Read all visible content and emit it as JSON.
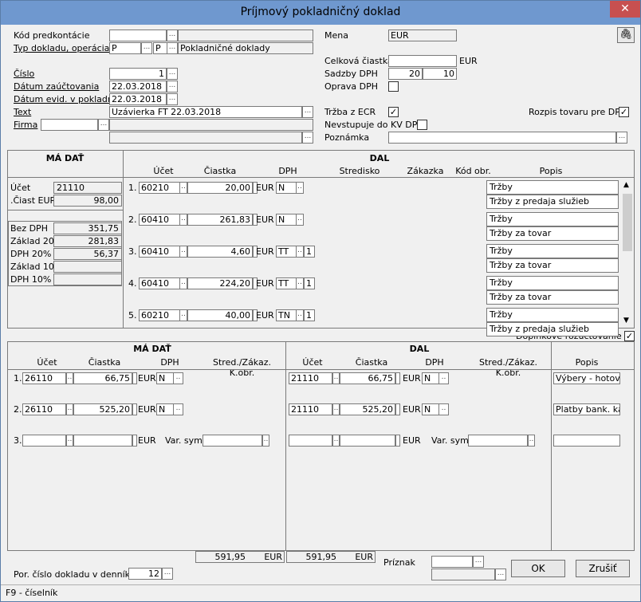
{
  "window": {
    "title": "Príjmový pokladničný doklad",
    "close": "✕"
  },
  "header": {
    "kod_label": "Kód predkontácie",
    "kod_value": "",
    "typ_label": "Typ dokladu, operácia",
    "typ_value": "P",
    "op_value": "P",
    "typ_desc": "Pokladničné doklady",
    "cislo_label": "Číslo",
    "cislo_value": "1",
    "datum_z_label": "Dátum zaúčtovania",
    "datum_z_value": "22.03.2018",
    "datum_e_label": "Dátum evid. v pokladni",
    "datum_e_value": "22.03.2018",
    "text_label": "Text",
    "text_value": "Uzávierka FT 22.03.2018",
    "firma_label": "Firma",
    "firma_value": "",
    "mena_label": "Mena",
    "mena_value": "EUR",
    "celkova_label": "Celková čiastka",
    "celkova_value": "",
    "celkova_unit": "EUR",
    "sadzby_label": "Sadzby DPH",
    "sadzba1": "20",
    "sadzba2": "10",
    "oprava_label": "Oprava DPH",
    "trzba_label": "Tržba z ECR",
    "nevstupuje_label": "Nevstupuje do KV DPH",
    "rozpis_label": "Rozpis tovaru pre DPH",
    "poznamka_label": "Poznámka",
    "poznamka_value": "",
    "attach_icon": "paperclip-icon"
  },
  "top": {
    "ma_dat_header": "MÁ DAŤ",
    "ucet_label": "Účet",
    "ucet_value": "21110",
    "ciast_label": ".Čiast EUR",
    "ciast_value": "98,00",
    "summary": [
      {
        "label": "Bez DPH",
        "value": "351,75"
      },
      {
        "label": "Základ 20%",
        "value": "281,83"
      },
      {
        "label": "DPH 20%",
        "value": "56,37"
      },
      {
        "label": "Základ 10%",
        "value": ""
      },
      {
        "label": "DPH 10%",
        "value": ""
      }
    ],
    "dal_header": "DAL",
    "cols": {
      "ucet": "Účet",
      "ciastka": "Čiastka",
      "dph": "DPH",
      "stredisko": "Stredisko",
      "zakazka": "Zákazka",
      "kod": "Kód obr.",
      "popis": "Popis"
    },
    "rows": [
      {
        "n": "1.",
        "ucet": "60210",
        "ciastka": "20,00",
        "cur": "EUR",
        "dph": "N",
        "extra": "",
        "popis1": "Tržby",
        "popis2": "Tržby z predaja služieb"
      },
      {
        "n": "2.",
        "ucet": "60410",
        "ciastka": "261,83",
        "cur": "EUR",
        "dph": "N",
        "extra": "",
        "popis1": "Tržby",
        "popis2": "Tržby za tovar"
      },
      {
        "n": "3.",
        "ucet": "60410",
        "ciastka": "4,60",
        "cur": "EUR",
        "dph": "TT",
        "extra": "1",
        "popis1": "Tržby",
        "popis2": "Tržby za tovar"
      },
      {
        "n": "4.",
        "ucet": "60410",
        "ciastka": "224,20",
        "cur": "EUR",
        "dph": "TT",
        "extra": "1",
        "popis1": "Tržby",
        "popis2": "Tržby za tovar"
      },
      {
        "n": "5.",
        "ucet": "60210",
        "ciastka": "40,00",
        "cur": "EUR",
        "dph": "TN",
        "extra": "1",
        "popis1": "Tržby",
        "popis2": "Tržby z predaja služieb"
      }
    ],
    "doplnkove_label": "Doplnkové rozúčtovanie"
  },
  "bottom": {
    "ma_dat_header": "MÁ DAŤ",
    "dal_header": "DAL",
    "cols": {
      "ucet": "Účet",
      "ciastka": "Čiastka",
      "dph": "DPH",
      "stred": "Stred./Zákaz. K.obr.",
      "popis": "Popis"
    },
    "rows": [
      {
        "n": "1.",
        "md_ucet": "26110",
        "md_ciastka": "66,75",
        "cur": "EUR",
        "md_dph": "N",
        "d_ucet": "21110",
        "d_ciastka": "66,75",
        "d_dph": "N",
        "popis": "Výbery - hotovos"
      },
      {
        "n": "2.",
        "md_ucet": "26110",
        "md_ciastka": "525,20",
        "cur": "EUR",
        "md_dph": "N",
        "d_ucet": "21110",
        "d_ciastka": "525,20",
        "d_dph": "N",
        "popis": "Platby bank. kar"
      },
      {
        "n": "3.",
        "md_ucet": "",
        "md_ciastka": "",
        "cur": "EUR",
        "var_label": "Var. sym.",
        "popis": ""
      }
    ],
    "sum_md": "591,95",
    "sum_md_cur": "EUR",
    "sum_d": "591,95",
    "sum_d_cur": "EUR"
  },
  "footer": {
    "priznak_label": "Príznak",
    "por_label": "Por. číslo dokladu v denníku",
    "por_value": "12",
    "ok": "OK",
    "zrusit": "Zrušiť",
    "status": "F9 - číselník"
  }
}
